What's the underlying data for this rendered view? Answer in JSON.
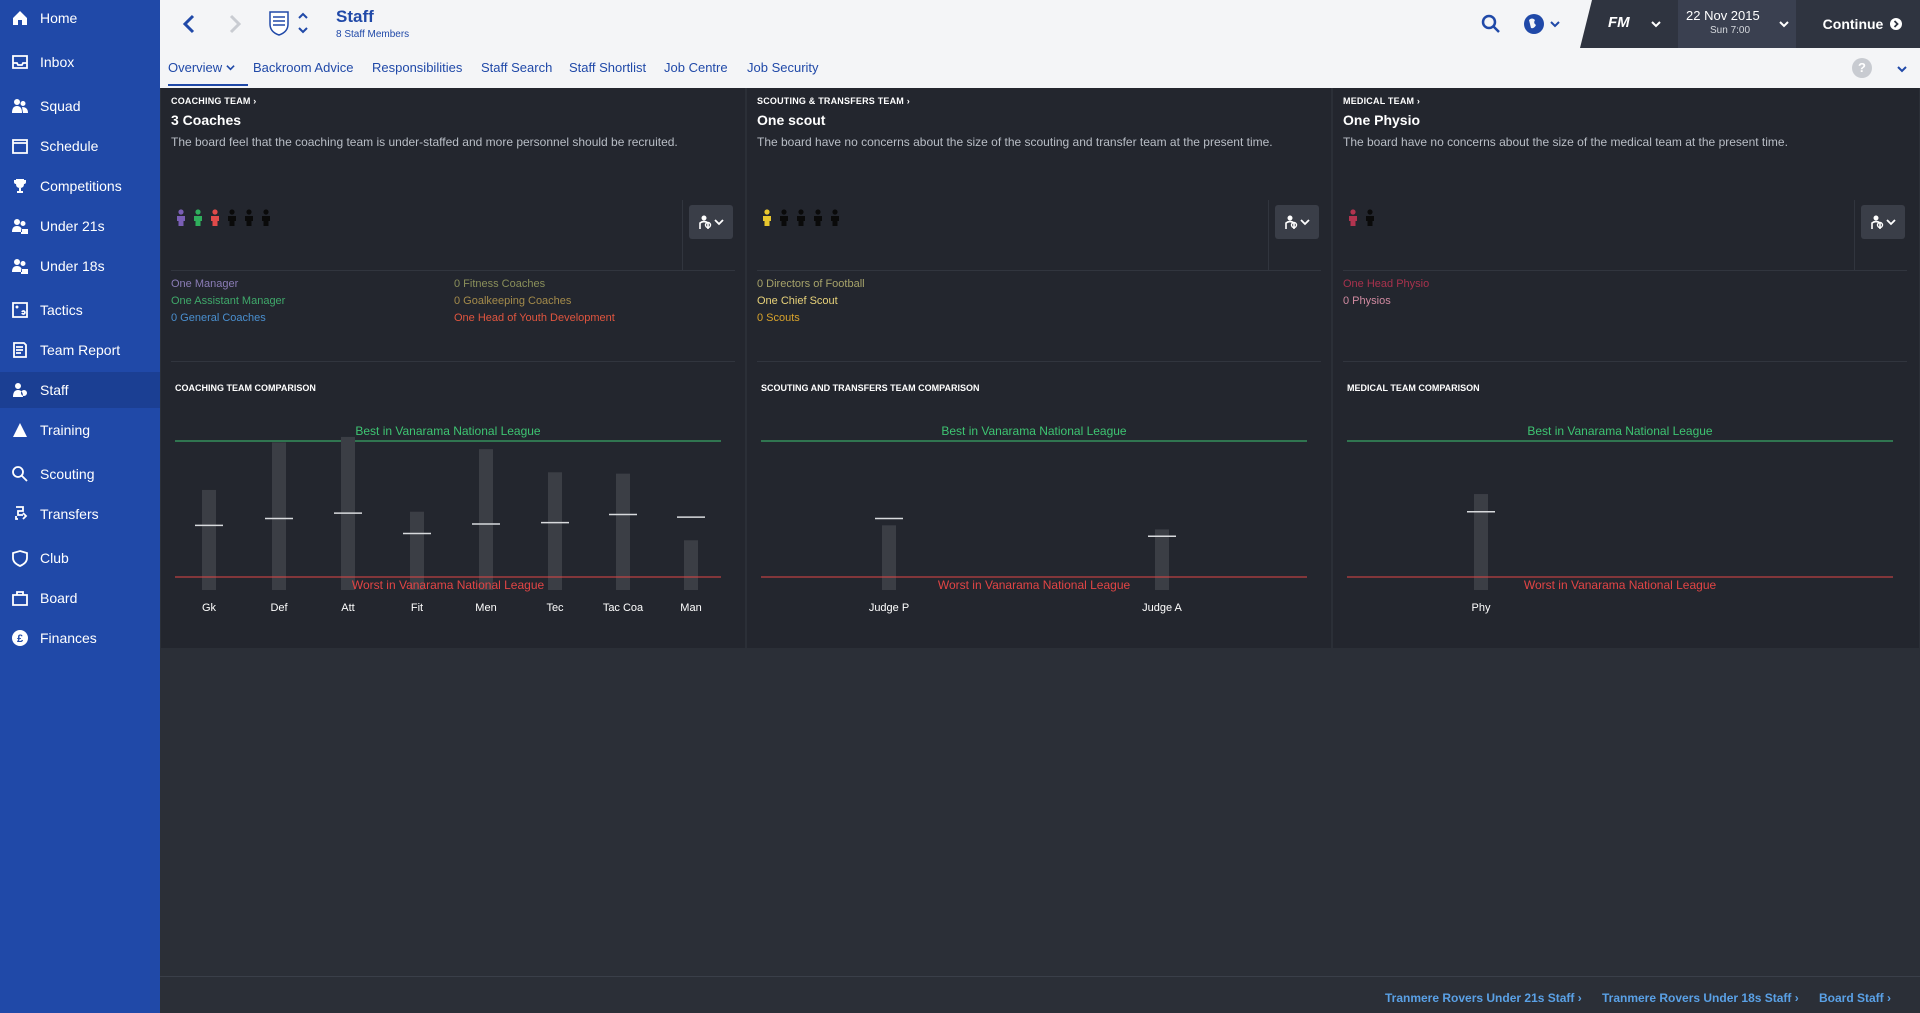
{
  "nav": {
    "items": [
      {
        "label": "Home",
        "icon": "home-icon"
      },
      {
        "label": "Inbox",
        "icon": "inbox-icon"
      },
      {
        "label": "Squad",
        "icon": "squad-icon"
      },
      {
        "label": "Schedule",
        "icon": "schedule-icon"
      },
      {
        "label": "Competitions",
        "icon": "trophy-icon"
      },
      {
        "label": "Under 21s",
        "icon": "under21-icon"
      },
      {
        "label": "Under 18s",
        "icon": "under18-icon"
      },
      {
        "label": "Tactics",
        "icon": "tactics-icon"
      },
      {
        "label": "Team Report",
        "icon": "report-icon"
      },
      {
        "label": "Staff",
        "icon": "staff-icon"
      },
      {
        "label": "Training",
        "icon": "training-icon"
      },
      {
        "label": "Scouting",
        "icon": "scouting-icon"
      },
      {
        "label": "Transfers",
        "icon": "transfers-icon"
      },
      {
        "label": "Club",
        "icon": "club-icon"
      },
      {
        "label": "Board",
        "icon": "board-icon"
      },
      {
        "label": "Finances",
        "icon": "finances-icon"
      }
    ],
    "active": "Staff"
  },
  "header": {
    "title": "Staff",
    "subtitle": "8 Staff Members",
    "date": "22 Nov 2015",
    "time": "Sun 7:00",
    "logo": "FM",
    "continue_label": "Continue",
    "help": "?"
  },
  "tabs": [
    "Overview",
    "Backroom Advice",
    "Responsibilities",
    "Staff Search",
    "Staff Shortlist",
    "Job Centre",
    "Job Security"
  ],
  "panels": {
    "coaching": {
      "head": "COACHING TEAM",
      "count": "3 Coaches",
      "desc": "The board feel that the coaching team is under-staffed and more personnel should be recruited.",
      "figure_colors": [
        "#7a5fb5",
        "#2fae5c",
        "#e04a4a",
        "#0a0a0a",
        "#0a0a0a",
        "#0a0a0a"
      ],
      "roles_left": [
        {
          "text": "One Manager",
          "color": "#8a7cb5"
        },
        {
          "text": "One Assistant Manager",
          "color": "#3fa86a"
        },
        {
          "text": "0 General Coaches",
          "color": "#4a8fcf"
        }
      ],
      "roles_right": [
        {
          "text": "0 Fitness Coaches",
          "color": "#8a8f5a"
        },
        {
          "text": "0 Goalkeeping Coaches",
          "color": "#a48b4b"
        },
        {
          "text": "One Head of Youth Development",
          "color": "#e0553f"
        }
      ],
      "comparison_title": "COACHING TEAM COMPARISON"
    },
    "scouting": {
      "head": "SCOUTING & TRANSFERS TEAM",
      "count": "One scout",
      "desc": "The board have no concerns about the size of the scouting and transfer team at the present time.",
      "figure_colors": [
        "#e8c72e",
        "#0a0a0a",
        "#0a0a0a",
        "#0a0a0a",
        "#0a0a0a"
      ],
      "roles_left": [
        {
          "text": "0 Directors of Football",
          "color": "#a7a36a"
        },
        {
          "text": "One Chief Scout",
          "color": "#e8d27a"
        },
        {
          "text": "0 Scouts",
          "color": "#d9a32b"
        }
      ],
      "comparison_title": "SCOUTING AND TRANSFERS TEAM COMPARISON"
    },
    "medical": {
      "head": "MEDICAL TEAM",
      "count": "One Physio",
      "desc": "The board have no concerns about the size of the medical team at the present time.",
      "figure_colors": [
        "#b2344f",
        "#0a0a0a"
      ],
      "roles_left": [
        {
          "text": "One Head Physio",
          "color": "#a8324d"
        },
        {
          "text": "0 Physios",
          "color": "#d08aa0"
        }
      ],
      "comparison_title": "MEDICAL TEAM COMPARISON"
    }
  },
  "comparison": {
    "best_label": "Best in Vanarama National League",
    "worst_label": "Worst in Vanarama National League",
    "best_color": "#3ec472",
    "worst_color": "#e24545"
  },
  "chart_data": [
    {
      "type": "bar",
      "title": "COACHING TEAM COMPARISON",
      "categories": [
        "Gk",
        "Def",
        "Att",
        "Fit",
        "Men",
        "Tec",
        "Tac Coa",
        "Man"
      ],
      "series": [
        {
          "values": [
            64,
            99,
            103,
            48,
            94,
            77,
            76,
            27
          ]
        },
        {
          "values": [
            38,
            43,
            47,
            32,
            39,
            40,
            46,
            44
          ]
        }
      ],
      "ylim": [
        0,
        100
      ]
    },
    {
      "type": "bar",
      "title": "SCOUTING AND TRANSFERS TEAM COMPARISON",
      "categories": [
        "Judge P",
        "Judge A"
      ],
      "series": [
        {
          "values": [
            38,
            35
          ]
        },
        {
          "values": [
            43,
            30
          ]
        }
      ],
      "ylim": [
        0,
        100
      ]
    },
    {
      "type": "bar",
      "title": "MEDICAL TEAM COMPARISON",
      "categories": [
        "Phy"
      ],
      "series": [
        {
          "values": [
            61
          ]
        },
        {
          "values": [
            48
          ]
        }
      ],
      "ylim": [
        0,
        100
      ]
    }
  ],
  "footer": {
    "links": [
      "Tranmere Rovers Under 21s Staff",
      "Tranmere Rovers Under 18s Staff",
      "Board Staff"
    ]
  }
}
